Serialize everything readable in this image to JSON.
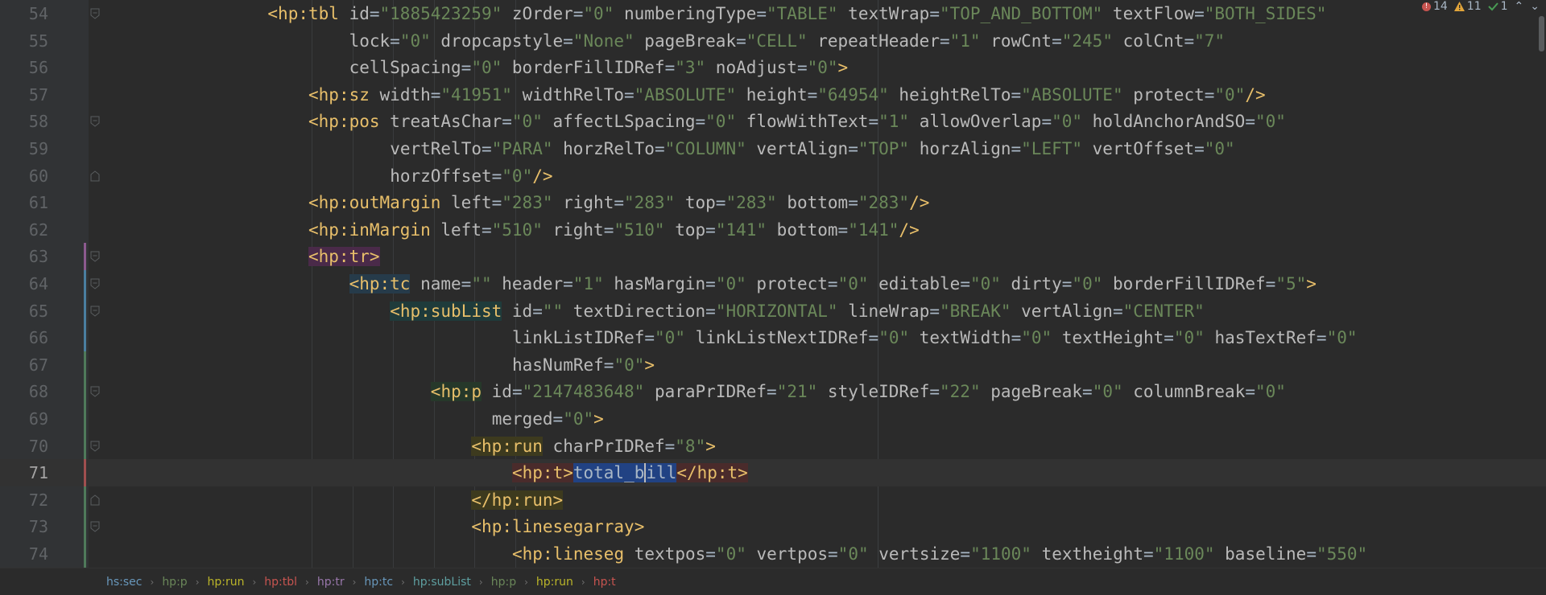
{
  "status": {
    "errors": "14",
    "warnings": "11",
    "weak_warnings": "1"
  },
  "current_line": 71,
  "lines": [
    {
      "n": "54",
      "indent": 16,
      "fold": "open",
      "segs": [
        [
          "<",
          "tag-b"
        ],
        [
          "hp:",
          "ns"
        ],
        [
          "tbl",
          "tag-b"
        ],
        [
          " id",
          "attr"
        ],
        [
          "=",
          "eq"
        ],
        [
          "\"1885423259\"",
          "val"
        ],
        [
          " zOrder",
          "attr"
        ],
        [
          "=",
          "eq"
        ],
        [
          "\"0\"",
          "val"
        ],
        [
          " numberingType",
          "attr"
        ],
        [
          "=",
          "eq"
        ],
        [
          "\"TABLE\"",
          "val"
        ],
        [
          " textWrap",
          "attr"
        ],
        [
          "=",
          "eq"
        ],
        [
          "\"TOP_AND_BOTTOM\"",
          "val"
        ],
        [
          " textFlow",
          "attr"
        ],
        [
          "=",
          "eq"
        ],
        [
          "\"BOTH_SIDES\"",
          "val"
        ]
      ]
    },
    {
      "n": "55",
      "indent": 24,
      "segs": [
        [
          "lock",
          "attr"
        ],
        [
          "=",
          "eq"
        ],
        [
          "\"0\"",
          "val"
        ],
        [
          " dropcapstyle",
          "attr"
        ],
        [
          "=",
          "eq"
        ],
        [
          "\"None\"",
          "val"
        ],
        [
          " pageBreak",
          "attr"
        ],
        [
          "=",
          "eq"
        ],
        [
          "\"CELL\"",
          "val"
        ],
        [
          " repeatHeader",
          "attr"
        ],
        [
          "=",
          "eq"
        ],
        [
          "\"1\"",
          "val"
        ],
        [
          " rowCnt",
          "attr"
        ],
        [
          "=",
          "eq"
        ],
        [
          "\"245\"",
          "val"
        ],
        [
          " colCnt",
          "attr"
        ],
        [
          "=",
          "eq"
        ],
        [
          "\"7\"",
          "val"
        ]
      ]
    },
    {
      "n": "56",
      "indent": 24,
      "segs": [
        [
          "cellSpacing",
          "attr"
        ],
        [
          "=",
          "eq"
        ],
        [
          "\"0\"",
          "val"
        ],
        [
          " borderFillIDRef",
          "attr"
        ],
        [
          "=",
          "eq"
        ],
        [
          "\"3\"",
          "val"
        ],
        [
          " noAdjust",
          "attr"
        ],
        [
          "=",
          "eq"
        ],
        [
          "\"0\"",
          "val"
        ],
        [
          ">",
          "tag-b"
        ]
      ]
    },
    {
      "n": "57",
      "indent": 20,
      "segs": [
        [
          "<",
          "tag-b"
        ],
        [
          "hp:",
          "ns"
        ],
        [
          "sz",
          "tag-b"
        ],
        [
          " width",
          "attr"
        ],
        [
          "=",
          "eq"
        ],
        [
          "\"41951\"",
          "val"
        ],
        [
          " widthRelTo",
          "attr"
        ],
        [
          "=",
          "eq"
        ],
        [
          "\"ABSOLUTE\"",
          "val"
        ],
        [
          " height",
          "attr"
        ],
        [
          "=",
          "eq"
        ],
        [
          "\"64954\"",
          "val"
        ],
        [
          " heightRelTo",
          "attr"
        ],
        [
          "=",
          "eq"
        ],
        [
          "\"ABSOLUTE\"",
          "val"
        ],
        [
          " protect",
          "attr"
        ],
        [
          "=",
          "eq"
        ],
        [
          "\"0\"",
          "val"
        ],
        [
          "/>",
          "tag-b"
        ]
      ]
    },
    {
      "n": "58",
      "indent": 20,
      "fold": "open",
      "segs": [
        [
          "<",
          "tag-b"
        ],
        [
          "hp:",
          "ns"
        ],
        [
          "pos",
          "tag-b"
        ],
        [
          " treatAsChar",
          "attr"
        ],
        [
          "=",
          "eq"
        ],
        [
          "\"0\"",
          "val"
        ],
        [
          " affectLSpacing",
          "attr"
        ],
        [
          "=",
          "eq"
        ],
        [
          "\"0\"",
          "val"
        ],
        [
          " flowWithText",
          "attr"
        ],
        [
          "=",
          "eq"
        ],
        [
          "\"1\"",
          "val"
        ],
        [
          " allowOverlap",
          "attr"
        ],
        [
          "=",
          "eq"
        ],
        [
          "\"0\"",
          "val"
        ],
        [
          " holdAnchorAndSO",
          "attr"
        ],
        [
          "=",
          "eq"
        ],
        [
          "\"0\"",
          "val"
        ]
      ]
    },
    {
      "n": "59",
      "indent": 28,
      "segs": [
        [
          "vertRelTo",
          "attr"
        ],
        [
          "=",
          "eq"
        ],
        [
          "\"PARA\"",
          "val"
        ],
        [
          " horzRelTo",
          "attr"
        ],
        [
          "=",
          "eq"
        ],
        [
          "\"COLUMN\"",
          "val"
        ],
        [
          " vertAlign",
          "attr"
        ],
        [
          "=",
          "eq"
        ],
        [
          "\"TOP\"",
          "val"
        ],
        [
          " horzAlign",
          "attr"
        ],
        [
          "=",
          "eq"
        ],
        [
          "\"LEFT\"",
          "val"
        ],
        [
          " vertOffset",
          "attr"
        ],
        [
          "=",
          "eq"
        ],
        [
          "\"0\"",
          "val"
        ]
      ]
    },
    {
      "n": "60",
      "indent": 28,
      "fold": "close",
      "segs": [
        [
          "horzOffset",
          "attr"
        ],
        [
          "=",
          "eq"
        ],
        [
          "\"0\"",
          "val"
        ],
        [
          "/>",
          "tag-b"
        ]
      ]
    },
    {
      "n": "61",
      "indent": 20,
      "segs": [
        [
          "<",
          "tag-b"
        ],
        [
          "hp:",
          "ns"
        ],
        [
          "outMargin",
          "tag-b"
        ],
        [
          " left",
          "attr"
        ],
        [
          "=",
          "eq"
        ],
        [
          "\"283\"",
          "val"
        ],
        [
          " right",
          "attr"
        ],
        [
          "=",
          "eq"
        ],
        [
          "\"283\"",
          "val"
        ],
        [
          " top",
          "attr"
        ],
        [
          "=",
          "eq"
        ],
        [
          "\"283\"",
          "val"
        ],
        [
          " bottom",
          "attr"
        ],
        [
          "=",
          "eq"
        ],
        [
          "\"283\"",
          "val"
        ],
        [
          "/>",
          "tag-b"
        ]
      ]
    },
    {
      "n": "62",
      "indent": 20,
      "segs": [
        [
          "<",
          "tag-b"
        ],
        [
          "hp:",
          "ns"
        ],
        [
          "inMargin",
          "tag-b"
        ],
        [
          " left",
          "attr"
        ],
        [
          "=",
          "eq"
        ],
        [
          "\"510\"",
          "val"
        ],
        [
          " right",
          "attr"
        ],
        [
          "=",
          "eq"
        ],
        [
          "\"510\"",
          "val"
        ],
        [
          " top",
          "attr"
        ],
        [
          "=",
          "eq"
        ],
        [
          "\"141\"",
          "val"
        ],
        [
          " bottom",
          "attr"
        ],
        [
          "=",
          "eq"
        ],
        [
          "\"141\"",
          "val"
        ],
        [
          "/>",
          "tag-b"
        ]
      ]
    },
    {
      "n": "63",
      "indent": 20,
      "fold": "open",
      "segs": [
        [
          "<hp:tr>",
          "tag-b hl-tr"
        ]
      ]
    },
    {
      "n": "64",
      "indent": 24,
      "fold": "open",
      "segs": [
        [
          "<hp:tc",
          "tag-b hl-tc"
        ],
        [
          " name",
          "attr"
        ],
        [
          "=",
          "eq"
        ],
        [
          "\"\"",
          "val"
        ],
        [
          " header",
          "attr"
        ],
        [
          "=",
          "eq"
        ],
        [
          "\"1\"",
          "val"
        ],
        [
          " hasMargin",
          "attr"
        ],
        [
          "=",
          "eq"
        ],
        [
          "\"0\"",
          "val"
        ],
        [
          " protect",
          "attr"
        ],
        [
          "=",
          "eq"
        ],
        [
          "\"0\"",
          "val"
        ],
        [
          " editable",
          "attr"
        ],
        [
          "=",
          "eq"
        ],
        [
          "\"0\"",
          "val"
        ],
        [
          " dirty",
          "attr"
        ],
        [
          "=",
          "eq"
        ],
        [
          "\"0\"",
          "val"
        ],
        [
          " borderFillIDRef",
          "attr"
        ],
        [
          "=",
          "eq"
        ],
        [
          "\"5\"",
          "val"
        ],
        [
          ">",
          "tag-b"
        ]
      ]
    },
    {
      "n": "65",
      "indent": 28,
      "fold": "open",
      "segs": [
        [
          "<hp:subList",
          "tag-b hl-sublist"
        ],
        [
          " id",
          "attr"
        ],
        [
          "=",
          "eq"
        ],
        [
          "\"\"",
          "val"
        ],
        [
          " textDirection",
          "attr"
        ],
        [
          "=",
          "eq"
        ],
        [
          "\"HORIZONTAL\"",
          "val"
        ],
        [
          " lineWrap",
          "attr"
        ],
        [
          "=",
          "eq"
        ],
        [
          "\"BREAK\"",
          "val"
        ],
        [
          " vertAlign",
          "attr"
        ],
        [
          "=",
          "eq"
        ],
        [
          "\"CENTER\"",
          "val"
        ]
      ]
    },
    {
      "n": "66",
      "indent": 40,
      "segs": [
        [
          "linkListIDRef",
          "attr"
        ],
        [
          "=",
          "eq"
        ],
        [
          "\"0\"",
          "val"
        ],
        [
          " linkListNextIDRef",
          "attr"
        ],
        [
          "=",
          "eq"
        ],
        [
          "\"0\"",
          "val"
        ],
        [
          " textWidth",
          "attr"
        ],
        [
          "=",
          "eq"
        ],
        [
          "\"0\"",
          "val"
        ],
        [
          " textHeight",
          "attr"
        ],
        [
          "=",
          "eq"
        ],
        [
          "\"0\"",
          "val"
        ],
        [
          " hasTextRef",
          "attr"
        ],
        [
          "=",
          "eq"
        ],
        [
          "\"0\"",
          "val"
        ]
      ]
    },
    {
      "n": "67",
      "indent": 40,
      "segs": [
        [
          "hasNumRef",
          "attr"
        ],
        [
          "=",
          "eq"
        ],
        [
          "\"0\"",
          "val"
        ],
        [
          ">",
          "tag-b"
        ]
      ]
    },
    {
      "n": "68",
      "indent": 32,
      "fold": "open",
      "segs": [
        [
          "<hp:p",
          "tag-b hl-p"
        ],
        [
          " id",
          "attr"
        ],
        [
          "=",
          "eq"
        ],
        [
          "\"2147483648\"",
          "val"
        ],
        [
          " paraPrIDRef",
          "attr"
        ],
        [
          "=",
          "eq"
        ],
        [
          "\"21\"",
          "val"
        ],
        [
          " styleIDRef",
          "attr"
        ],
        [
          "=",
          "eq"
        ],
        [
          "\"22\"",
          "val"
        ],
        [
          " pageBreak",
          "attr"
        ],
        [
          "=",
          "eq"
        ],
        [
          "\"0\"",
          "val"
        ],
        [
          " columnBreak",
          "attr"
        ],
        [
          "=",
          "eq"
        ],
        [
          "\"0\"",
          "val"
        ]
      ]
    },
    {
      "n": "69",
      "indent": 38,
      "segs": [
        [
          "merged",
          "attr"
        ],
        [
          "=",
          "eq"
        ],
        [
          "\"0\"",
          "val"
        ],
        [
          ">",
          "tag-b"
        ]
      ]
    },
    {
      "n": "70",
      "indent": 36,
      "fold": "open",
      "segs": [
        [
          "<hp:run",
          "tag-b hl-run"
        ],
        [
          " charPrIDRef",
          "attr"
        ],
        [
          "=",
          "eq"
        ],
        [
          "\"8\"",
          "val"
        ],
        [
          ">",
          "tag-b"
        ]
      ]
    },
    {
      "n": "71",
      "indent": 40,
      "current": true,
      "segs": [
        [
          "<hp:t>",
          "tag-b hl-t"
        ],
        [
          "total_b",
          "sel"
        ],
        [
          "|",
          "caretmark"
        ],
        [
          "ill",
          "sel"
        ],
        [
          "</hp:t>",
          "tag-b hl-t"
        ]
      ]
    },
    {
      "n": "72",
      "indent": 36,
      "fold": "close",
      "segs": [
        [
          "</hp:run>",
          "tag-b hl-run"
        ]
      ]
    },
    {
      "n": "73",
      "indent": 36,
      "fold": "open",
      "segs": [
        [
          "<",
          "tag-b"
        ],
        [
          "hp:",
          "ns"
        ],
        [
          "linesegarray",
          "tag-b"
        ],
        [
          ">",
          "tag-b"
        ]
      ]
    },
    {
      "n": "74",
      "indent": 40,
      "segs": [
        [
          "<",
          "tag-b"
        ],
        [
          "hp:",
          "ns"
        ],
        [
          "lineseg",
          "tag-b"
        ],
        [
          " textpos",
          "attr"
        ],
        [
          "=",
          "eq"
        ],
        [
          "\"0\"",
          "val"
        ],
        [
          " vertpos",
          "attr"
        ],
        [
          "=",
          "eq"
        ],
        [
          "\"0\"",
          "val"
        ],
        [
          " vertsize",
          "attr"
        ],
        [
          "=",
          "eq"
        ],
        [
          "\"1100\"",
          "val"
        ],
        [
          " textheight",
          "attr"
        ],
        [
          "=",
          "eq"
        ],
        [
          "\"1100\"",
          "val"
        ],
        [
          " baseline",
          "attr"
        ],
        [
          "=",
          "eq"
        ],
        [
          "\"550\"",
          "val"
        ]
      ]
    }
  ],
  "breadcrumbs": [
    {
      "label": "hs:sec",
      "color": "#6897bb"
    },
    {
      "label": "hp:p",
      "color": "#6a8759"
    },
    {
      "label": "hp:run",
      "color": "#bbb529"
    },
    {
      "label": "hp:tbl",
      "color": "#c75450"
    },
    {
      "label": "hp:tr",
      "color": "#9876aa"
    },
    {
      "label": "hp:tc",
      "color": "#6897bb"
    },
    {
      "label": "hp:subList",
      "color": "#5e9fa0"
    },
    {
      "label": "hp:p",
      "color": "#6a8759"
    },
    {
      "label": "hp:run",
      "color": "#bbb529"
    },
    {
      "label": "hp:t",
      "color": "#c75450"
    }
  ]
}
